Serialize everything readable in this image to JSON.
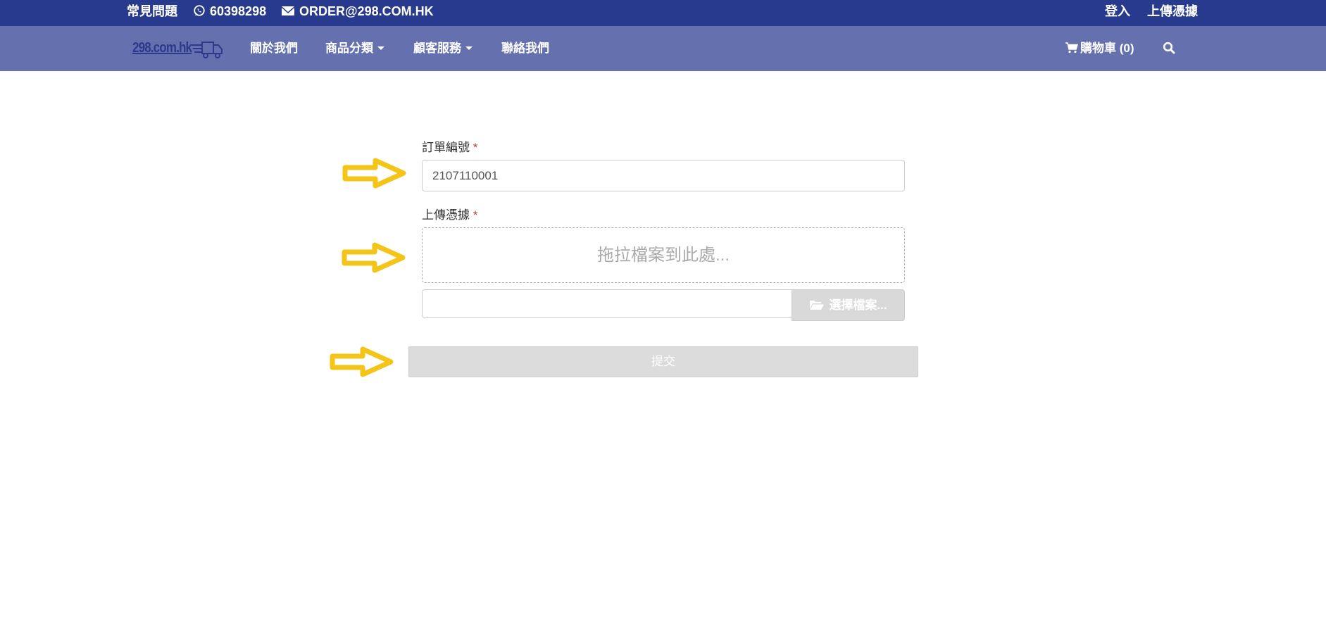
{
  "topbar": {
    "faq_label": "常見問題",
    "phone": "60398298",
    "email": "ORDER@298.COM.HK",
    "login_label": "登入",
    "upload_label": "上傳憑據"
  },
  "navbar": {
    "logo_text": "298.com.hk",
    "items": [
      {
        "label": "關於我們"
      },
      {
        "label": "商品分類"
      },
      {
        "label": "顧客服務"
      },
      {
        "label": "聯絡我們"
      }
    ],
    "cart_label": "購物車 (0)"
  },
  "form": {
    "order_label": "訂單編號",
    "required_mark": "*",
    "order_value": "2107110001",
    "upload_label": "上傳憑據",
    "dropzone_text": "拖拉檔案到此處...",
    "file_value": "",
    "browse_label": "選擇檔案...",
    "submit_label": "提交"
  },
  "colors": {
    "topbar_bg": "#283a8e",
    "navbar_bg": "#6571ae",
    "arrow": "#f4c518"
  }
}
